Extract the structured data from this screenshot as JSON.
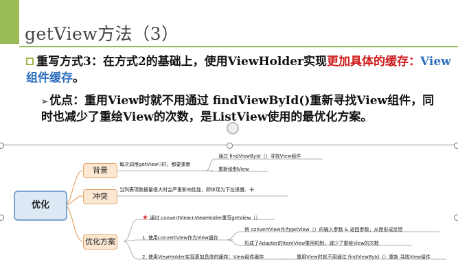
{
  "slide": {
    "title": "getView方法（3）",
    "bullet1": {
      "prefix": "重写方式3：在方式2的基础上，使用ViewHolder实现",
      "red_text": "更加具体的缓存：",
      "blue_text": "View组件缓存",
      "suffix": "。"
    },
    "bullet2": {
      "text": "优点：重用View时就不用通过 findViewById()重新寻找View组件，同时也减少了重绘View的次数，是ListView使用的最优化方案。"
    }
  },
  "mindmap": {
    "root": "优化",
    "branches": [
      {
        "label": "背景",
        "text": "每次调用getView()时，都要重新",
        "children": [
          "通过 findViewById（）寻找View组件",
          "重新绘制View"
        ]
      },
      {
        "label": "冲突",
        "text": "当列表项数据量很大时会严重影响性能，即体现为下拉很慢、卡"
      },
      {
        "label": "优化方案",
        "star_item": "通过 convertView+ViewHolder重写getView（）",
        "items": [
          {
            "text": "1. 使用convertView作为View缓存",
            "children": [
              "将 convertView作为getView（）的输入参数 & 返回参数，从而形成反馈",
              "形成了Adapter的itemView重用机制，减少了重绘View的次数"
            ]
          },
          {
            "text": "2. 使用ViewHolder实现更加具体的缓存：View组件缓存",
            "children": [
              "重用View时就不用通过 findViewById（）重新 寻找View组件"
            ]
          }
        ]
      }
    ]
  },
  "colors": {
    "accent_green": "#9bbb59",
    "red": "#d0191a",
    "blue": "#2f6fc0"
  }
}
